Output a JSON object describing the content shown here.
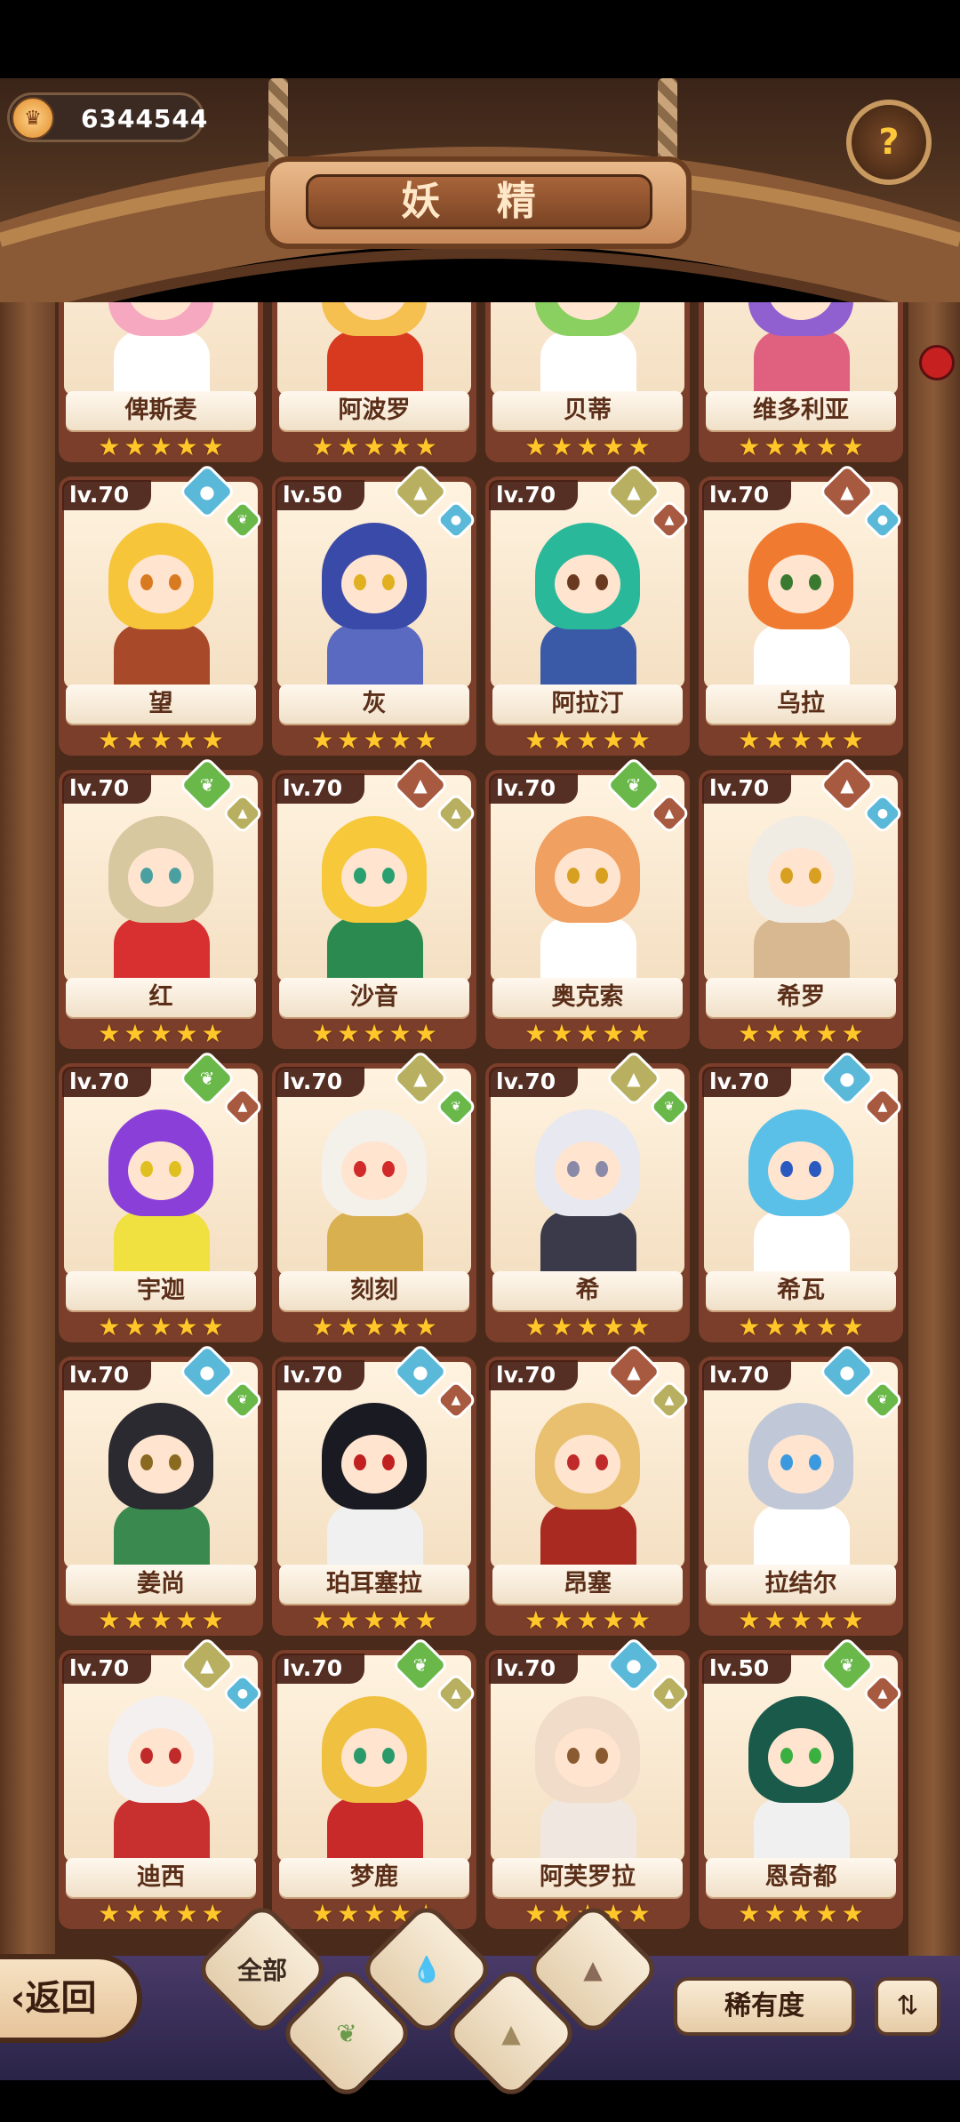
{
  "currency": {
    "icon": "crown-coin-icon",
    "value": "6344544"
  },
  "title": "妖 精",
  "help_icon": "question-sprout-icon",
  "fairies": [
    {
      "name": "俾斯麦",
      "level": "",
      "stars": 5,
      "elements": [],
      "hair": "#f6a8c0",
      "outfit": "#ffffff",
      "eye": "#7a6ad8"
    },
    {
      "name": "阿波罗",
      "level": "",
      "stars": 5,
      "elements": [],
      "hair": "#f6c050",
      "outfit": "#d83a20",
      "eye": "#c85a20"
    },
    {
      "name": "贝蒂",
      "level": "",
      "stars": 5,
      "elements": [],
      "hair": "#8ad060",
      "outfit": "#ffffff",
      "eye": "#4a9a40"
    },
    {
      "name": "维多利亚",
      "level": "",
      "stars": 5,
      "elements": [],
      "hair": "#9060d0",
      "outfit": "#e06080",
      "eye": "#3a9aa0"
    },
    {
      "name": "望",
      "level": "lv.70",
      "stars": 5,
      "elements": [
        "water",
        "grass"
      ],
      "hair": "#f6c53a",
      "outfit": "#a84a2a",
      "eye": "#d87a20"
    },
    {
      "name": "灰",
      "level": "lv.50",
      "stars": 5,
      "elements": [
        "rock",
        "water"
      ],
      "hair": "#3a4aa8",
      "outfit": "#5a6ac0",
      "eye": "#e0b020"
    },
    {
      "name": "阿拉汀",
      "level": "lv.70",
      "stars": 5,
      "elements": [
        "rock",
        "fire"
      ],
      "hair": "#2ab89a",
      "outfit": "#3a5aa8",
      "eye": "#6a3a20"
    },
    {
      "name": "乌拉",
      "level": "lv.70",
      "stars": 5,
      "elements": [
        "fire",
        "water"
      ],
      "hair": "#f07a30",
      "outfit": "#ffffff",
      "eye": "#3a7a30"
    },
    {
      "name": "红",
      "level": "lv.70",
      "stars": 5,
      "elements": [
        "grass",
        "rock"
      ],
      "hair": "#d8c8a0",
      "outfit": "#d83030",
      "eye": "#4aa0a0"
    },
    {
      "name": "沙音",
      "level": "lv.70",
      "stars": 5,
      "elements": [
        "fire",
        "rock"
      ],
      "hair": "#f6c83a",
      "outfit": "#2a8a50",
      "eye": "#2aa070"
    },
    {
      "name": "奥克索",
      "level": "lv.70",
      "stars": 5,
      "elements": [
        "grass",
        "fire"
      ],
      "hair": "#f0a060",
      "outfit": "#ffffff",
      "eye": "#d8a020"
    },
    {
      "name": "希罗",
      "level": "lv.70",
      "stars": 5,
      "elements": [
        "fire",
        "water"
      ],
      "hair": "#f0ece4",
      "outfit": "#d8b890",
      "eye": "#d8a020"
    },
    {
      "name": "宇迦",
      "level": "lv.70",
      "stars": 5,
      "elements": [
        "grass",
        "fire"
      ],
      "hair": "#8a40d8",
      "outfit": "#f0e040",
      "eye": "#e0c020"
    },
    {
      "name": "刻刻",
      "level": "lv.70",
      "stars": 5,
      "elements": [
        "rock",
        "grass"
      ],
      "hair": "#f4f0ea",
      "outfit": "#d8b050",
      "eye": "#d02a2a"
    },
    {
      "name": "希",
      "level": "lv.70",
      "stars": 5,
      "elements": [
        "rock",
        "grass"
      ],
      "hair": "#e8e8f0",
      "outfit": "#3a3a4a",
      "eye": "#8a8aa8"
    },
    {
      "name": "希瓦",
      "level": "lv.70",
      "stars": 5,
      "elements": [
        "water",
        "fire"
      ],
      "hair": "#5ac0e8",
      "outfit": "#ffffff",
      "eye": "#2a5ac0"
    },
    {
      "name": "姜尚",
      "level": "lv.70",
      "stars": 5,
      "elements": [
        "water",
        "grass"
      ],
      "hair": "#2a2a30",
      "outfit": "#3a8a50",
      "eye": "#8a6a20"
    },
    {
      "name": "珀耳塞拉",
      "level": "lv.70",
      "stars": 5,
      "elements": [
        "water",
        "fire"
      ],
      "hair": "#1a1a22",
      "outfit": "#f0f0f0",
      "eye": "#c02020"
    },
    {
      "name": "昂塞",
      "level": "lv.70",
      "stars": 5,
      "elements": [
        "fire",
        "rock"
      ],
      "hair": "#e8c070",
      "outfit": "#a82a20",
      "eye": "#c02a2a"
    },
    {
      "name": "拉结尔",
      "level": "lv.70",
      "stars": 5,
      "elements": [
        "water",
        "grass"
      ],
      "hair": "#c0c8d8",
      "outfit": "#ffffff",
      "eye": "#3a9ae0"
    },
    {
      "name": "迪西",
      "level": "lv.70",
      "stars": 5,
      "elements": [
        "rock",
        "water"
      ],
      "hair": "#f4f0f0",
      "outfit": "#c83030",
      "eye": "#c02a2a"
    },
    {
      "name": "梦鹿",
      "level": "lv.70",
      "stars": 5,
      "elements": [
        "grass",
        "rock"
      ],
      "hair": "#f0c040",
      "outfit": "#c82a2a",
      "eye": "#2a9a6a"
    },
    {
      "name": "阿芙罗拉",
      "level": "lv.70",
      "stars": 5,
      "elements": [
        "water",
        "rock"
      ],
      "hair": "#f0dcc8",
      "outfit": "#f0e8e0",
      "eye": "#8a5a30"
    },
    {
      "name": "恩奇都",
      "level": "lv.50",
      "stars": 5,
      "elements": [
        "grass",
        "fire"
      ],
      "hair": "#1a5a4a",
      "outfit": "#f0f0f0",
      "eye": "#3ab040"
    }
  ],
  "element_colors": {
    "water": "#5ab8d8",
    "grass": "#6ab84a",
    "rock": "#b8b060",
    "fire": "#a85a40"
  },
  "bottom": {
    "back_label": "返回",
    "filters": [
      {
        "label": "全部",
        "icon": ""
      },
      {
        "label": "",
        "icon": "grass-sprout-icon"
      },
      {
        "label": "",
        "icon": "water-drop-icon"
      },
      {
        "label": "",
        "icon": "rock-mountain-icon"
      },
      {
        "label": "",
        "icon": "fire-mountain-icon"
      }
    ],
    "rarity_label": "稀有度",
    "sort_icon": "sort-order-icon"
  }
}
